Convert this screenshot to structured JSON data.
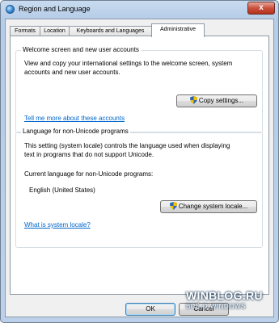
{
  "window": {
    "title": "Region and Language",
    "close_glyph": "x"
  },
  "tabs": [
    {
      "label": "Formats"
    },
    {
      "label": "Location"
    },
    {
      "label": "Keyboards and Languages"
    },
    {
      "label": "Administrative",
      "active": true
    }
  ],
  "welcome_group": {
    "title": "Welcome screen and new user accounts",
    "description_line1": "View and copy your international settings to the welcome screen, system",
    "description_line2": "accounts and new user accounts.",
    "copy_button": "Copy settings...",
    "link": "Tell me more about these accounts"
  },
  "unicode_group": {
    "title": "Language for non-Unicode programs",
    "description_line1": "This setting (system locale) controls the language used when displaying",
    "description_line2": "text in programs that do not support Unicode.",
    "current_label": "Current language for non-Unicode programs:",
    "current_value": "English (United States)",
    "change_button": "Change system locale...",
    "link": "What is system locale?"
  },
  "footer": {
    "ok": "OK",
    "cancel": "Cancel"
  },
  "watermark": {
    "line1": "WINBLOG.RU",
    "line2": "ВСЁ О WINDOWS"
  },
  "colors": {
    "link": "#0066cc",
    "title_bar": "#b6cde8",
    "close_button": "#c9513e"
  },
  "icons": {
    "window": "globe-icon",
    "buttons": "uac-shield-icon"
  }
}
